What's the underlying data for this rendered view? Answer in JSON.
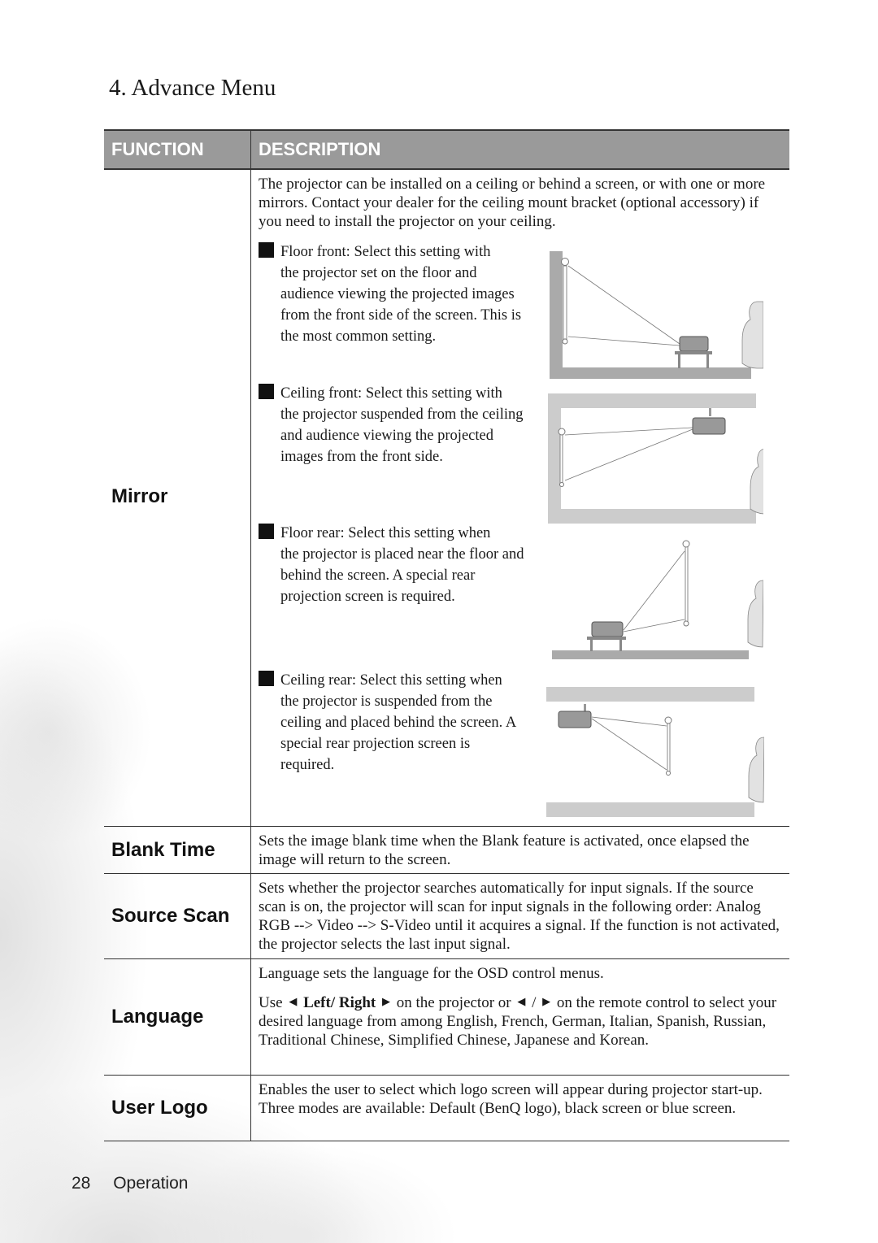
{
  "section_title": "4. Advance Menu",
  "table": {
    "headers": {
      "function": "FUNCTION",
      "description": "DESCRIPTION"
    },
    "colors": {
      "header_bg": "#9a9a9a",
      "header_text": "#ffffff",
      "rule": "#333333"
    },
    "rows": [
      {
        "function": "Mirror",
        "intro": "The projector can be installed on a ceiling or behind a screen, or with one or more mirrors. Contact your dealer for the ceiling mount bracket (optional accessory) if you need to install the projector on your ceiling.",
        "options": [
          {
            "lead": "Floor front: Select this setting with",
            "rest": "the projector set on the floor and audience viewing the projected images from the front side of the screen. This is the most common setting.",
            "diagram": "floor-front-diagram"
          },
          {
            "lead": "Ceiling front: Select this setting with",
            "rest": "the projector suspended from the ceiling and audience viewing the projected images from the front side.",
            "diagram": "ceiling-front-diagram"
          },
          {
            "lead": "Floor rear: Select this setting when",
            "rest": "the projector is placed near the floor and behind the screen. A special rear projection screen is required.",
            "diagram": "floor-rear-diagram"
          },
          {
            "lead": "Ceiling rear: Select this setting when",
            "rest": "the projector is suspended from the ceiling and placed behind the screen. A special rear projection screen is required.",
            "diagram": "ceiling-rear-diagram"
          }
        ]
      },
      {
        "function": "Blank Time",
        "description": "Sets the image blank time when the Blank feature is activated, once elapsed the image will return to the screen."
      },
      {
        "function": "Source Scan",
        "description": "Sets whether the projector searches automatically for input signals. If the source scan is on, the projector will scan for input signals in the following order: Analog RGB --> Video --> S-Video until it acquires a signal. If the function is not activated, the projector selects the last input signal."
      },
      {
        "function": "Language",
        "para1": "Language sets the language for the OSD control menus.",
        "para2_prefix": "Use",
        "para2_keys": "Left/ Right",
        "para2_mid": "on the projector or",
        "para2_slash": "/",
        "para2_suffix": "on the remote control to select your desired language from among English, French, German, Italian, Spanish, Russian, Traditional Chinese, Simplified Chinese, Japanese and Korean.",
        "icons": {
          "left": "left-arrow-icon",
          "right": "right-arrow-icon"
        }
      },
      {
        "function": "User Logo",
        "description": "Enables the user to select which logo screen will appear during projector start-up. Three modes are available: Default (BenQ logo), black screen or blue screen."
      }
    ]
  },
  "footer": {
    "page_number": "28",
    "section": "Operation"
  }
}
